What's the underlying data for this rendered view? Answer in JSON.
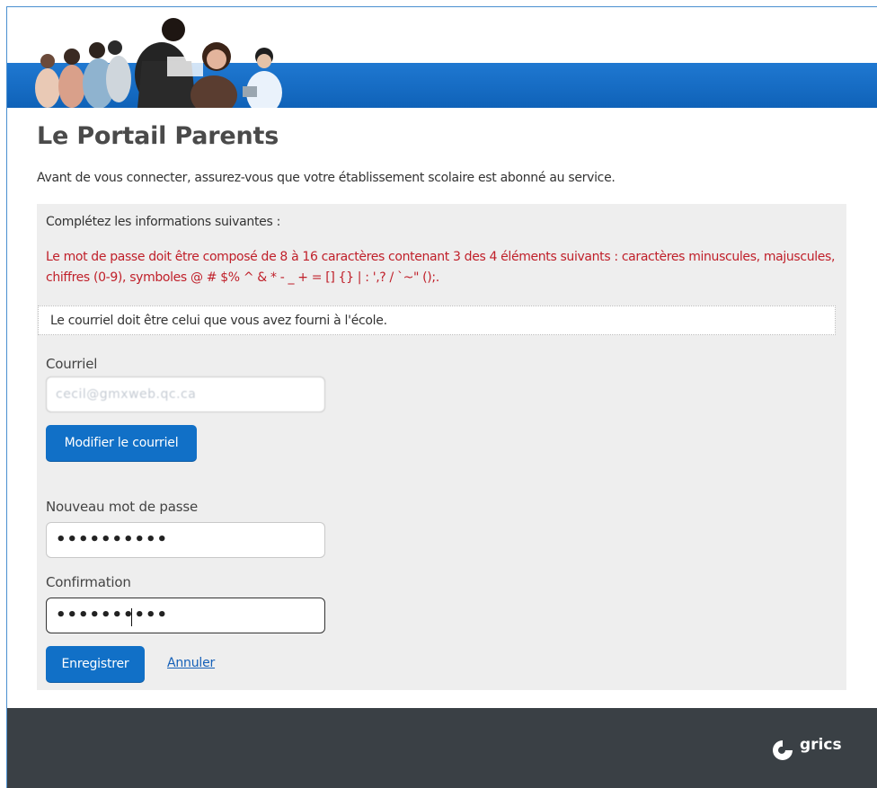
{
  "page": {
    "title": "Le Portail Parents",
    "intro": "Avant de vous connecter, assurez-vous que votre établissement scolaire est abonné au service."
  },
  "form": {
    "instructions": "Complétez les informations suivantes :",
    "password_rules": "Le mot de passe doit être composé de 8 à 16 caractères contenant 3 des 4 éléments suivants : caractères minuscules, majuscules, chiffres (0-9), symboles @ # $% ^ & * - _ + = [] {} | : ',? / `~\" ();.",
    "notice": "Le courriel doit être celui que vous avez fourni à l'école.",
    "email": {
      "label": "Courriel",
      "value": "cecil@gmxweb.qc.ca"
    },
    "modify_email_button": "Modifier le courriel",
    "new_password": {
      "label": "Nouveau mot de passe",
      "value": "••••••••••"
    },
    "confirmation": {
      "label": "Confirmation",
      "value": "••••••••••"
    },
    "save_button": "Enregistrer",
    "cancel_link": "Annuler"
  },
  "footer": {
    "brand": "grics",
    "logo_icon": "grics-logo-icon"
  },
  "colors": {
    "banner_blue": "#1170c7",
    "accent_button": "#1170c7",
    "error_text": "#c0202a",
    "footer_bg": "#3a4045",
    "link": "#1560b8"
  }
}
